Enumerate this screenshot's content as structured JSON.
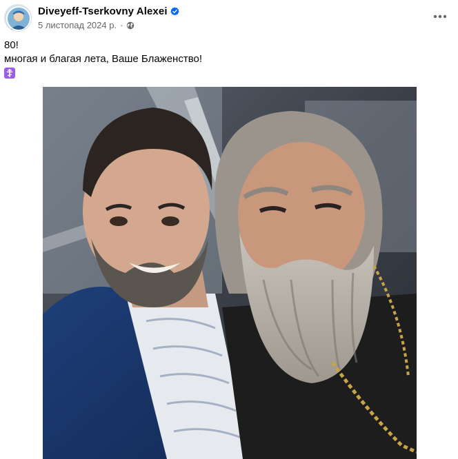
{
  "post": {
    "author": "Diveyeff-Tserkovny Alexei",
    "date": "5 листопад 2024 р.",
    "separator": "·",
    "text_line1": "80!",
    "text_line2": "многая и благая лета, Ваше Блаженство!",
    "icons": {
      "avatar": "profile-avatar",
      "verified": "verified-badge-icon",
      "audience": "globe-icon",
      "more": "more-options-icon",
      "emoji": "orthodox-cross-emoji-icon"
    },
    "colors": {
      "verified_blue": "#0866ff",
      "emoji_purple": "#9b5de5",
      "secondary_text": "#65676b"
    }
  }
}
